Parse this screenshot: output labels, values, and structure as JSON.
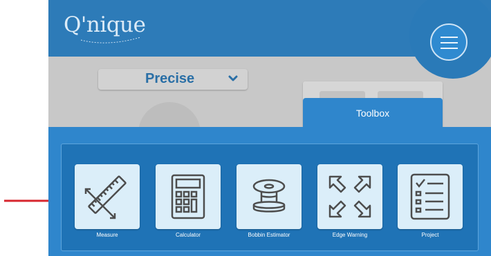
{
  "app": {
    "logo_text": "Q'nique"
  },
  "header": {
    "menu_icon": "hamburger-menu-icon"
  },
  "mode_select": {
    "value": "Precise",
    "icon": "chevron-down-icon"
  },
  "toolbox": {
    "title": "Toolbox",
    "tools": [
      {
        "label": "Measure",
        "icon": "ruler-icon"
      },
      {
        "label": "Calculator",
        "icon": "calculator-icon"
      },
      {
        "label": "Bobbin Estimator",
        "icon": "bobbin-icon"
      },
      {
        "label": "Edge Warning",
        "icon": "expand-arrows-icon"
      },
      {
        "label": "Project",
        "icon": "checklist-icon"
      }
    ]
  },
  "annotation": {
    "arrow_color": "#d7262e",
    "target": "Measure"
  },
  "colors": {
    "header_blue": "#2d7bb8",
    "toolbox_blue": "#2f86cc",
    "tile_background": "#dbeef9",
    "icon_stroke": "#4d4d4d",
    "dimmed_gray": "#c8c8c8"
  }
}
